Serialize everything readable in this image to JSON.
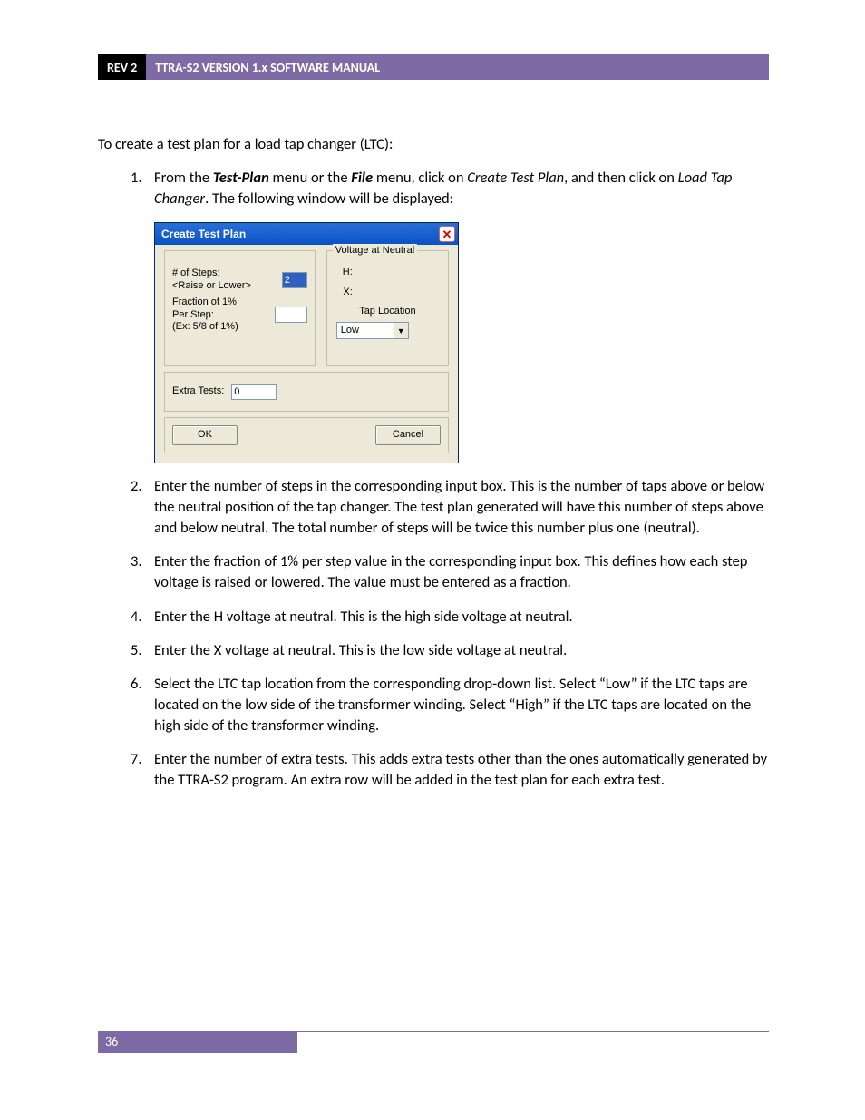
{
  "header": {
    "rev": "REV 2",
    "title": "TTRA-S2 VERSION 1.x SOFTWARE MANUAL"
  },
  "intro": "To create a test plan for a load tap changer (LTC):",
  "steps": [
    {
      "num": "1.",
      "prefix": "From the ",
      "menu1": "Test-Plan",
      "mid1": " menu or the ",
      "menu2": "File",
      "mid2": " menu, click on ",
      "action1": "Create Test Plan",
      "mid3": ", and then click on ",
      "action2": "Load Tap Changer",
      "suffix": ". The following window will be displayed:"
    },
    {
      "num": "2.",
      "text": "Enter the number of steps in the corresponding input box. This is the number of taps above or below the neutral position of the tap changer. The test plan generated will have this number of steps above and below neutral. The total number of steps will be twice this number plus one (neutral)."
    },
    {
      "num": "3.",
      "text": "Enter the fraction of 1% per step value in the corresponding input box. This defines how each step voltage is raised or lowered. The value must be entered as a fraction."
    },
    {
      "num": "4.",
      "text": "Enter the H voltage at neutral. This is the high side voltage at neutral."
    },
    {
      "num": "5.",
      "text": "Enter the X voltage at neutral. This is the low side voltage at neutral."
    },
    {
      "num": "6.",
      "text": "Select the LTC tap location from the corresponding drop-down list. Select “Low” if the LTC taps are located on the low side of the transformer winding. Select “High” if the LTC taps are located on the high side of the transformer winding."
    },
    {
      "num": "7.",
      "text": "Enter the number of extra tests. This adds extra tests other than the ones automatically generated by the TTRA-S2 program. An extra row will be added in the test plan for each extra test."
    }
  ],
  "dialog": {
    "title": "Create Test Plan",
    "steps_label": "# of Steps:\n<Raise or Lower>",
    "steps_value": "2",
    "fraction_label": "Fraction of 1%\nPer Step:\n(Ex: 5/8 of 1%)",
    "voltage_legend": "Voltage at Neutral",
    "h_label": "H:",
    "x_label": "X:",
    "tap_label": "Tap Location",
    "tap_value": "Low",
    "extra_label": "Extra Tests:",
    "extra_value": "0",
    "ok": "OK",
    "cancel": "Cancel"
  },
  "footer": {
    "page": "36"
  }
}
